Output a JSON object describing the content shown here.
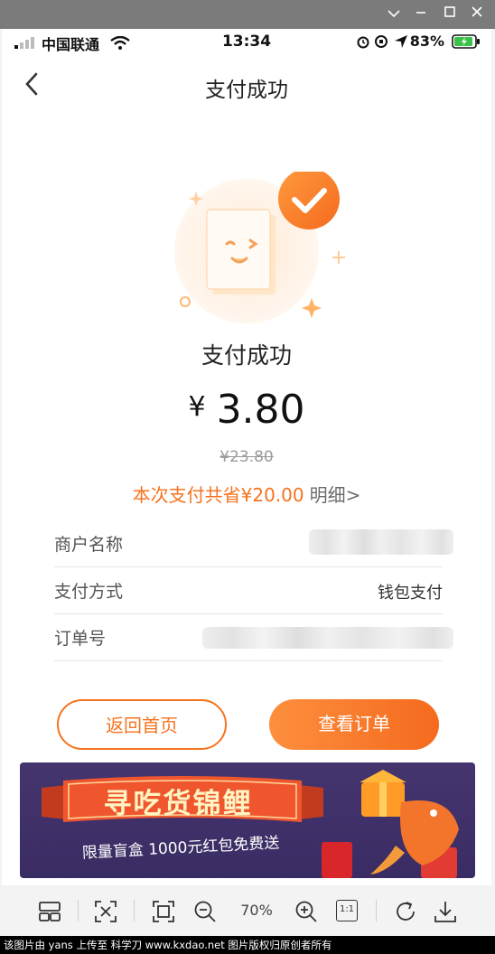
{
  "status_bar": {
    "carrier": "中国联通",
    "time": "13:34",
    "battery": "83%"
  },
  "nav": {
    "title": "支付成功"
  },
  "result": {
    "title": "支付成功",
    "currency": "¥",
    "amount": "3.80",
    "original_price": "¥23.80",
    "savings": "本次支付共省¥20.00",
    "detail_link": "明细>"
  },
  "details": [
    {
      "label": "商户名称",
      "value": ""
    },
    {
      "label": "支付方式",
      "value": "钱包支付"
    },
    {
      "label": "订单号",
      "value": ""
    }
  ],
  "buttons": {
    "home": "返回首页",
    "order": "查看订单"
  },
  "banner": {
    "title": "寻吃货锦鲤",
    "subtitle": "限量盲盒 1000元红包免费送"
  },
  "viewer": {
    "zoom": "70%",
    "actual_size": "1:1"
  },
  "footer": {
    "text": "该图片由 yans 上传至 科学刀 www.kxdao.net 图片版权归原创者所有"
  },
  "colors": {
    "accent": "#f5731f",
    "banner_bg": "#3a2c63"
  }
}
